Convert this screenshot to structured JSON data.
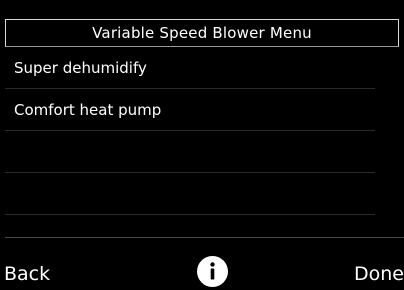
{
  "header": {
    "title": "Variable Speed Blower Menu"
  },
  "menu": {
    "items": [
      {
        "label": "Super dehumidify"
      },
      {
        "label": "Comfort heat pump"
      },
      {
        "label": ""
      },
      {
        "label": ""
      }
    ]
  },
  "footer": {
    "back_label": "Back",
    "done_label": "Done",
    "info_icon": "info-icon"
  },
  "colors": {
    "background": "#000000",
    "text": "#ffffff",
    "title_border": "#d8d8d8",
    "divider": "#4a4a4a"
  }
}
